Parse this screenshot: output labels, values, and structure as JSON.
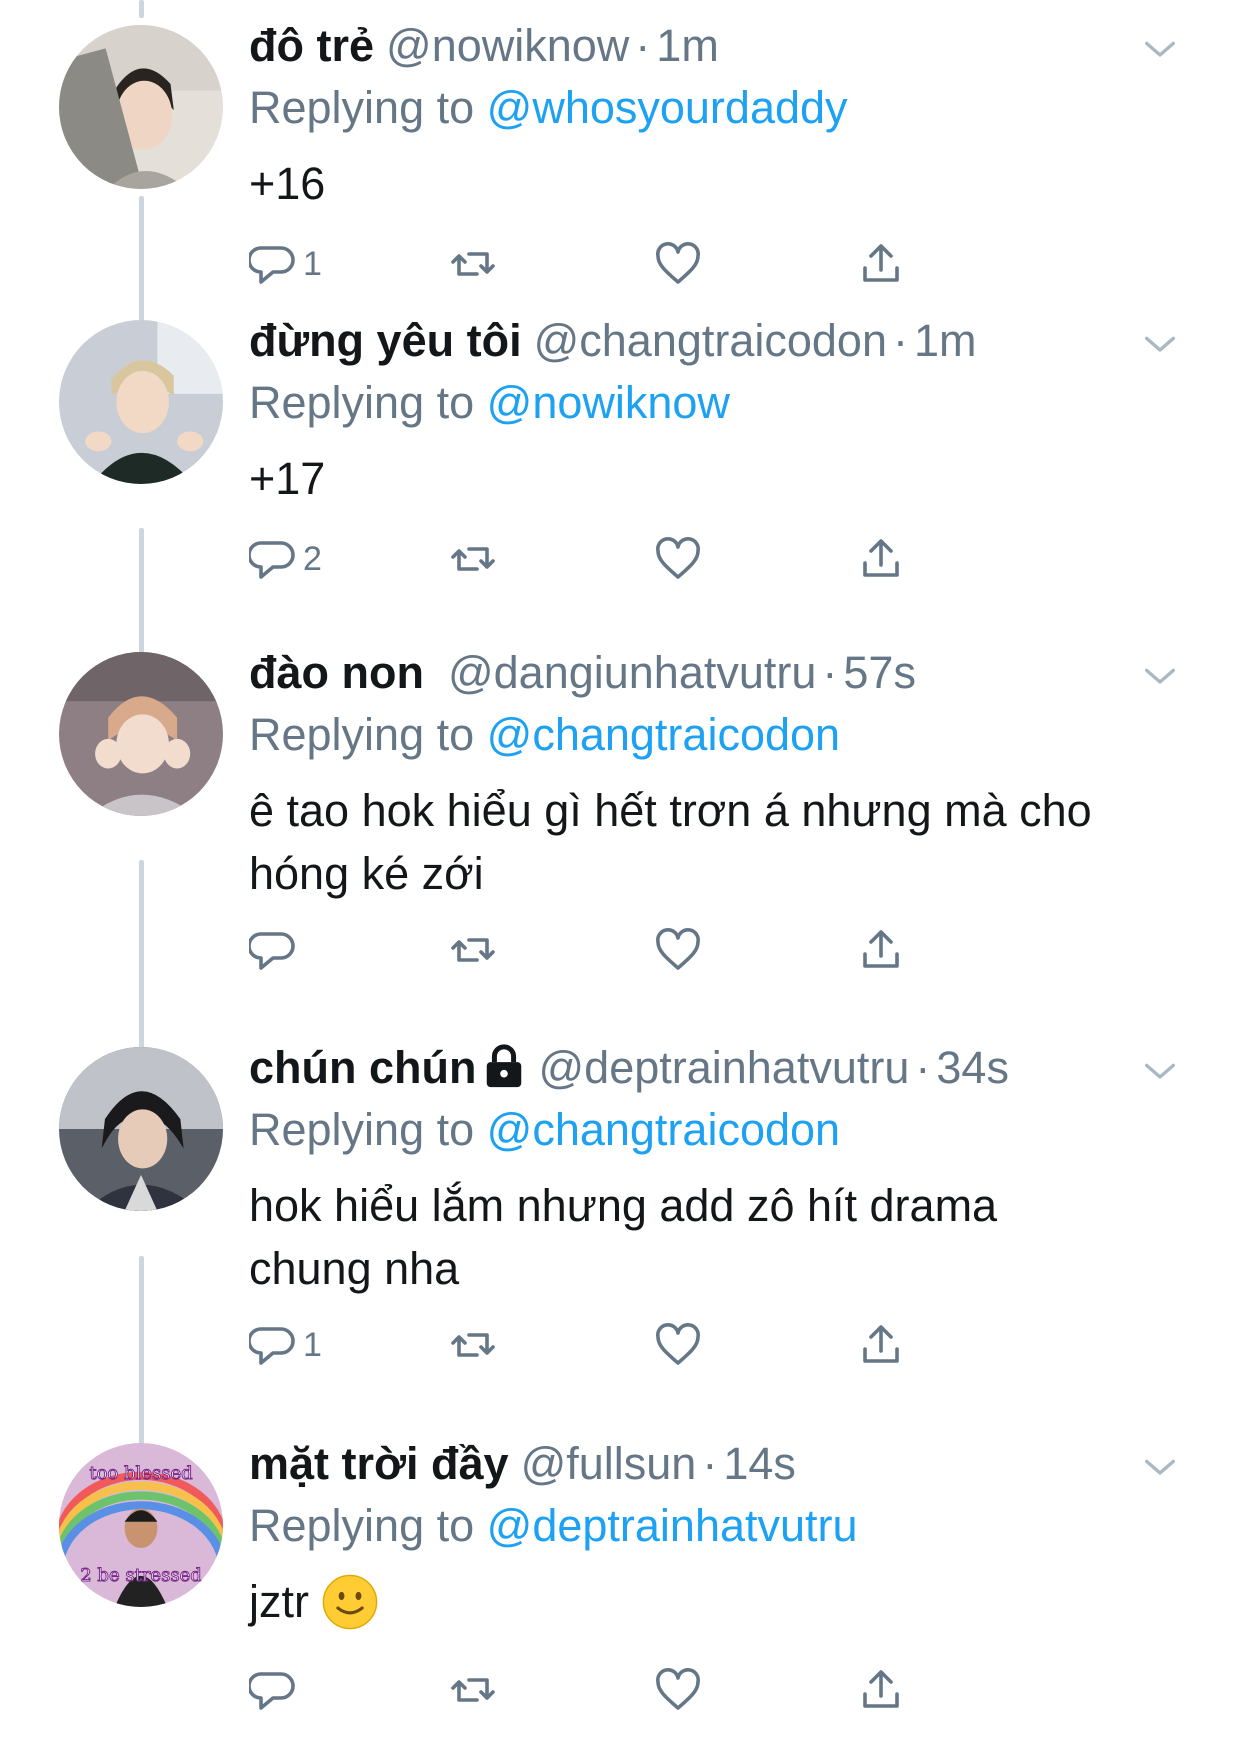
{
  "colors": {
    "accent": "#1da1f2",
    "secondary_text": "#657786",
    "primary_text": "#14171a",
    "thread_line": "#ccd6dd"
  },
  "tweets": [
    {
      "name": "đô trẻ",
      "handle": "@nowiknow",
      "dot": "·",
      "time": "1m",
      "replying_prefix": "Replying to ",
      "replying_to": "@whosyourdaddy",
      "text": "+16",
      "reply_count": "1",
      "avatar": "avatar-photo"
    },
    {
      "name": "đừng yêu tôi",
      "handle": "@changtraicodon",
      "dot": "·",
      "time": "1m",
      "replying_prefix": "Replying to ",
      "replying_to": "@nowiknow",
      "text": "+17",
      "reply_count": "2",
      "avatar": "avatar-photo"
    },
    {
      "name": "đào non",
      "handle": "@dangiunhatvutru",
      "dot": "·",
      "time": "57s",
      "replying_prefix": "Replying to ",
      "replying_to": "@changtraicodon",
      "text_line1": "ê tao hok hiểu gì hết trơn á nhưng mà cho",
      "text_line2": "hóng ké zới",
      "reply_count": "",
      "avatar": "avatar-photo"
    },
    {
      "name": "chún chún",
      "protected_icon": "lock-icon",
      "handle": "@deptrainhatvutru",
      "dot": "·",
      "time": "34s",
      "replying_prefix": "Replying to ",
      "replying_to": "@changtraicodon",
      "text_line1": "hok hiểu lắm nhưng add zô hít drama",
      "text_line2": "chung nha",
      "reply_count": "1",
      "avatar": "avatar-photo"
    },
    {
      "name": "mặt trời đầy",
      "handle": "@fullsun",
      "dot": "·",
      "time": "14s",
      "replying_prefix": "Replying to ",
      "replying_to": "@deptrainhatvutru",
      "text": "jztr",
      "emoji": "slightly-smiling-face",
      "reply_count": "",
      "avatar_caption_top": "too blessed",
      "avatar_caption_bottom": "2 be stressed",
      "avatar": "avatar-photo"
    }
  ],
  "action_icons": [
    "reply-icon",
    "retweet-icon",
    "like-icon",
    "share-icon"
  ]
}
